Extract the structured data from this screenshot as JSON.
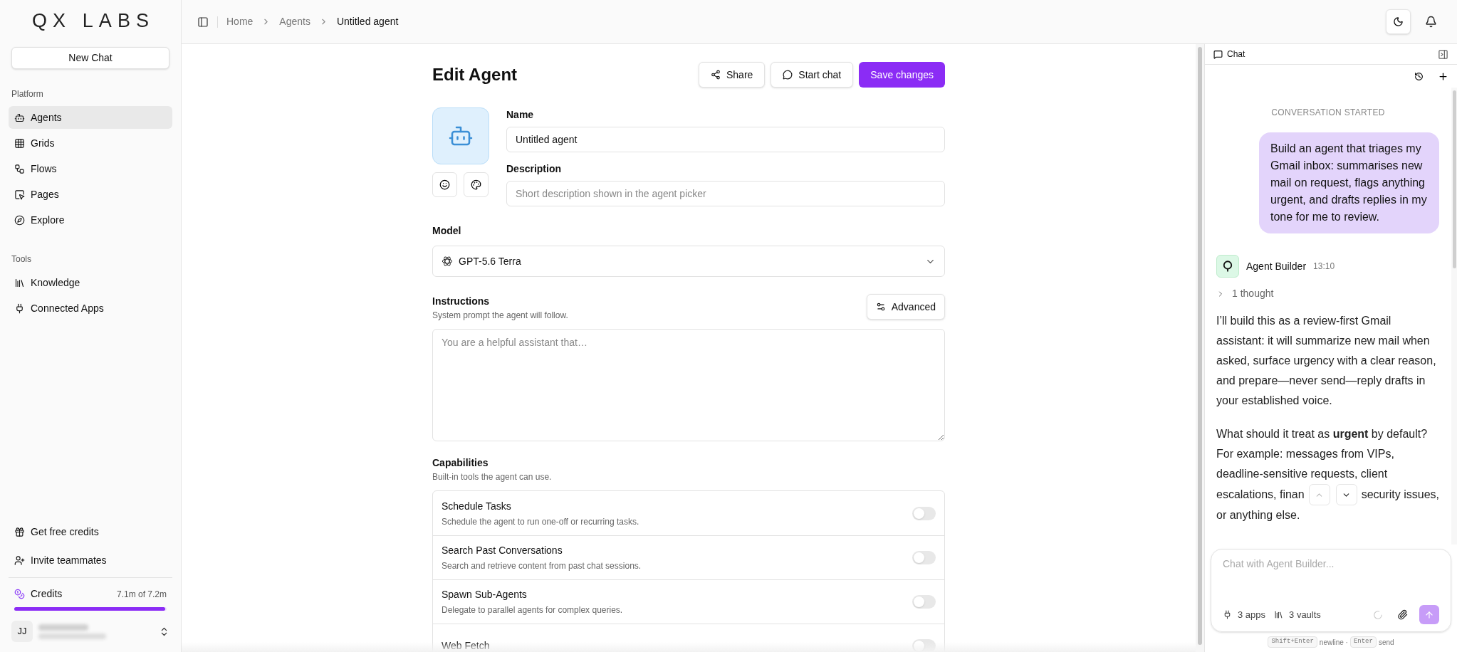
{
  "brand": {
    "logo": "QX LABS"
  },
  "sidebar": {
    "new_chat": "New Chat",
    "sections": [
      {
        "title": "Platform",
        "items": [
          {
            "label": "Agents",
            "selected": true
          },
          {
            "label": "Grids",
            "selected": false
          },
          {
            "label": "Flows",
            "selected": false
          },
          {
            "label": "Pages",
            "selected": false
          },
          {
            "label": "Explore",
            "selected": false
          }
        ]
      },
      {
        "title": "Tools",
        "items": [
          {
            "label": "Knowledge",
            "selected": false
          },
          {
            "label": "Connected Apps",
            "selected": false
          }
        ]
      }
    ],
    "footer_links": [
      "Get free credits",
      "Invite teammates"
    ],
    "credits": {
      "label": "Credits",
      "reading": "7.1m of 7.2m",
      "level": 0.99
    },
    "user": {
      "initials": "JJ"
    }
  },
  "breadcrumbs": [
    {
      "label": "Home",
      "current": false
    },
    {
      "label": "Agents",
      "current": false
    },
    {
      "label": "Untitled agent",
      "current": true
    }
  ],
  "editor": {
    "title": "Edit Agent",
    "actions": [
      {
        "label": "Share",
        "kind": "outline"
      },
      {
        "label": "Start chat",
        "kind": "outline"
      },
      {
        "label": "Save changes",
        "kind": "primary"
      }
    ],
    "name": {
      "label": "Name",
      "value": "Untitled agent"
    },
    "description": {
      "label": "Description",
      "placeholder": "Short description shown in the agent picker"
    },
    "model": {
      "label": "Model",
      "value": "GPT-5.6 Terra"
    },
    "instructions": {
      "label": "Instructions",
      "hint": "System prompt the agent will follow.",
      "placeholder": "You are a helpful assistant that…",
      "advanced": "Advanced"
    },
    "capabilities": {
      "title": "Capabilities",
      "hint": "Built-in tools the agent can use.",
      "items": [
        {
          "name": "Schedule Tasks",
          "description": "Schedule the agent to run one-off or recurring tasks.",
          "on": false
        },
        {
          "name": "Search Past Conversations",
          "description": "Search and retrieve content from past chat sessions.",
          "on": false
        },
        {
          "name": "Spawn Sub-Agents",
          "description": "Delegate to parallel agents for complex queries.",
          "on": false
        },
        {
          "name": "Web Fetch",
          "on": false
        }
      ]
    }
  },
  "chat": {
    "title": "Chat",
    "divider": "CONVERSATION STARTED",
    "user_message": "Build an agent that triages my Gmail inbox: summarises new mail on request, flags anything urgent, and drafts replies in my tone for me to review.",
    "agent": {
      "name": "Agent Builder",
      "time": "13:10",
      "thought": "1 thought",
      "paragraph": "I’ll build this as a review-first Gmail assistant: it will summarize new mail when asked, surface urgency with a clear reason, and prepare—never send—reply drafts in your established voice.",
      "question_start": "What should it treat as **urgent** by default? For example: messages from VIPs, deadline-sensitive requests, client",
      "question_left": "escalations, finan",
      "question_right": "security issues,",
      "question_end": "or anything else."
    },
    "input": {
      "placeholder": "Chat with Agent Builder...",
      "apps": "3 apps",
      "vaults": "3 vaults"
    },
    "hint": [
      {
        "kind": "key",
        "text": "Shift+Enter"
      },
      {
        "kind": "text",
        "text": "newline ·"
      },
      {
        "kind": "key",
        "text": "Enter"
      },
      {
        "kind": "text",
        "text": "send"
      }
    ]
  }
}
